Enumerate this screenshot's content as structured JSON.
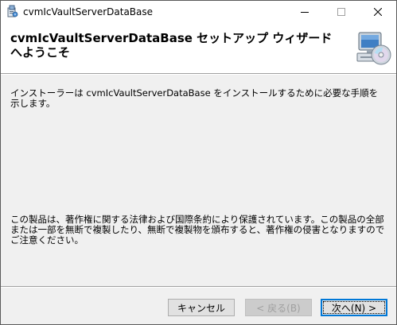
{
  "window": {
    "title": "cvmIcVaultServerDataBase",
    "app_icon": "installer-icon",
    "controls": {
      "minimize": "minimize-icon",
      "maximize": "maximize-icon",
      "close": "close-icon"
    }
  },
  "header": {
    "title": "cvmIcVaultServerDataBase セットアップ ウィザードへようこそ",
    "graphic": "computer-cd-icon"
  },
  "body": {
    "intro": "インストーラーは cvmIcVaultServerDataBase をインストールするために必要な手順を示します。",
    "copyright": "この製品は、著作権に関する法律および国際条約により保護されています。この製品の全部または一部を無断で複製したり、無断で複製物を頒布すると、著作権の侵害となりますのでご注意ください。"
  },
  "buttons": {
    "cancel": "キャンセル",
    "back": "< 戻る(B)",
    "next": "次へ(N) >",
    "back_enabled": false
  },
  "colors": {
    "accent": "#0078d7",
    "dialog_background": "#f0f0f0",
    "header_background": "#ffffff"
  }
}
